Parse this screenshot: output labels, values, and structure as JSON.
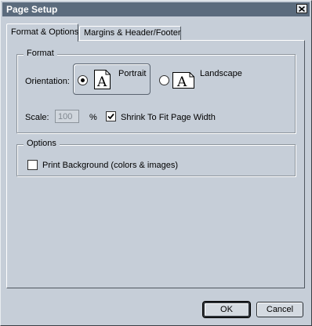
{
  "window": {
    "title": "Page Setup",
    "close_icon": "close-icon"
  },
  "tabs": [
    {
      "label": "Format & Options",
      "active": true
    },
    {
      "label": "Margins & Header/Footer",
      "active": false
    }
  ],
  "format": {
    "group_label": "Format",
    "orientation_label": "Orientation:",
    "orientation_options": [
      {
        "label": "Portrait",
        "selected": true,
        "icon": "portrait-page-icon"
      },
      {
        "label": "Landscape",
        "selected": false,
        "icon": "landscape-page-icon"
      }
    ],
    "scale_label": "Scale:",
    "scale_value": "100",
    "scale_unit": "%",
    "shrink_label": "Shrink To Fit Page Width",
    "shrink_checked": true
  },
  "options": {
    "group_label": "Options",
    "print_background_label": "Print Background (colors & images)",
    "print_background_checked": false
  },
  "buttons": {
    "ok_label": "OK",
    "cancel_label": "Cancel"
  }
}
